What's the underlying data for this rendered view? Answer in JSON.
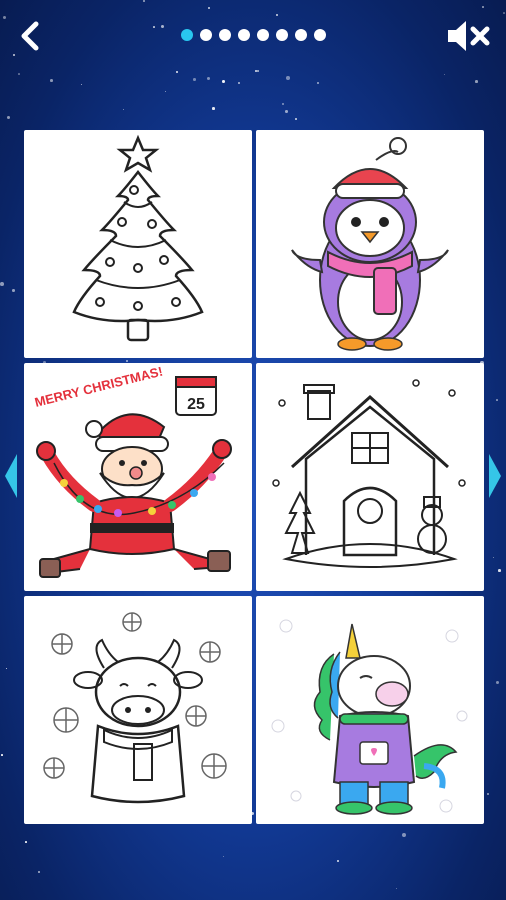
{
  "header": {
    "back_icon": "back-chevron-icon",
    "mute_icon": "speaker-muted-icon",
    "pages_total": 8,
    "page_current": 1
  },
  "pictures": [
    {
      "name": "christmas-tree",
      "colored": false
    },
    {
      "name": "penguin",
      "colored": true
    },
    {
      "name": "santa",
      "colored": true,
      "caption": "MERRY CHRISTMAS!",
      "calendar_day": "25"
    },
    {
      "name": "winter-house",
      "colored": false
    },
    {
      "name": "bull",
      "colored": false
    },
    {
      "name": "unicorn",
      "colored": true
    }
  ],
  "nav": {
    "prev_icon": "arrow-left-icon",
    "next_icon": "arrow-right-icon"
  },
  "colors": {
    "accent": "#29c7f0",
    "bg_top": "#0a2466",
    "bg_center": "#1f4fb8"
  }
}
